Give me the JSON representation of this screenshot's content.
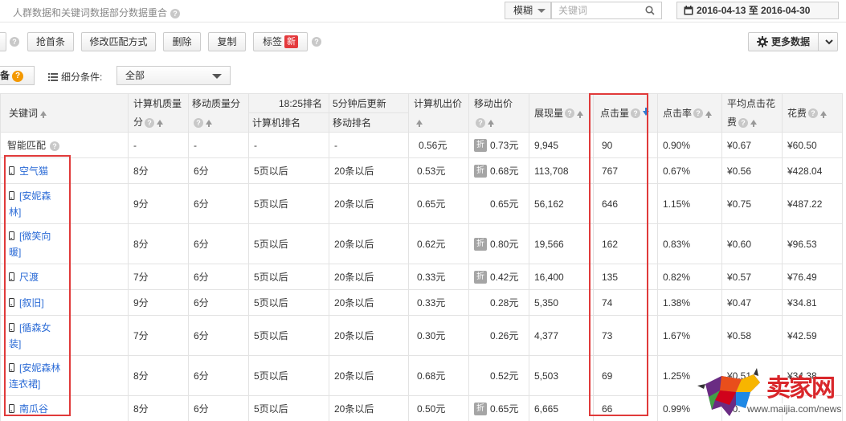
{
  "topbar": {
    "title": "人群数据和关键词数据部分数据重合",
    "fuzzy_label": "模糊",
    "search_placeholder": "关键词",
    "date_range": "2016-04-13 至 2016-04-30"
  },
  "toolbar": {
    "btn_grab": "抢首条",
    "btn_modify_match": "修改匹配方式",
    "btn_delete": "删除",
    "btn_copy": "复制",
    "btn_tag": "标签",
    "tag_badge": "新",
    "more_data": "更多数据"
  },
  "filter": {
    "equip_label": "备",
    "equip_badge": "?",
    "condition_label": "细分条件:",
    "condition_value": "全部"
  },
  "table": {
    "headers": {
      "keyword": "关键词",
      "pc_quality_line1": "计算机质量",
      "pc_quality_line2": "分",
      "mobile_quality": "移动质量分",
      "rank_time": "18:25排名",
      "update_note": "5分钟后更新",
      "pc_rank": "计算机排名",
      "mobile_rank": "移动排名",
      "pc_bid": "计算机出价",
      "mobile_bid": "移动出价",
      "impressions": "展现量",
      "clicks": "点击量",
      "ctr": "点击率",
      "avg_cpc_line1": "平均点击花",
      "avg_cpc_line2": "费",
      "cost": "花费"
    },
    "summary": {
      "keyword": "智能匹配",
      "pc_quality": "-",
      "mobile_quality": "-",
      "pc_rank": "-",
      "mobile_rank": "-",
      "pc_bid": "0.56元",
      "mobile_bid": "0.73元",
      "impressions": "9,945",
      "clicks": "90",
      "ctr": "0.90%",
      "avg_cpc": "¥0.67",
      "cost": "¥60.50"
    },
    "discount_label": "折",
    "rows": [
      {
        "kw1": "空气猫",
        "kw2": "",
        "pc_quality": "8分",
        "mobile_quality": "6分",
        "pc_rank": "5页以后",
        "mobile_rank": "20条以后",
        "pc_bid": "0.53元",
        "mobile_bid": "0.68元",
        "discount": true,
        "impressions": "113,708",
        "clicks": "767",
        "ctr": "0.67%",
        "avg_cpc": "¥0.56",
        "cost": "¥428.04"
      },
      {
        "kw1": "[安妮森",
        "kw2": "林]",
        "pc_quality": "9分",
        "mobile_quality": "6分",
        "pc_rank": "5页以后",
        "mobile_rank": "20条以后",
        "pc_bid": "0.65元",
        "mobile_bid": "0.65元",
        "discount": false,
        "impressions": "56,162",
        "clicks": "646",
        "ctr": "1.15%",
        "avg_cpc": "¥0.75",
        "cost": "¥487.22"
      },
      {
        "kw1": "[微笑向",
        "kw2": "暖]",
        "pc_quality": "8分",
        "mobile_quality": "6分",
        "pc_rank": "5页以后",
        "mobile_rank": "20条以后",
        "pc_bid": "0.62元",
        "mobile_bid": "0.80元",
        "discount": true,
        "impressions": "19,566",
        "clicks": "162",
        "ctr": "0.83%",
        "avg_cpc": "¥0.60",
        "cost": "¥96.53"
      },
      {
        "kw1": "尺渡",
        "kw2": "",
        "pc_quality": "7分",
        "mobile_quality": "6分",
        "pc_rank": "5页以后",
        "mobile_rank": "20条以后",
        "pc_bid": "0.33元",
        "mobile_bid": "0.42元",
        "discount": true,
        "impressions": "16,400",
        "clicks": "135",
        "ctr": "0.82%",
        "avg_cpc": "¥0.57",
        "cost": "¥76.49"
      },
      {
        "kw1": "[叙旧]",
        "kw2": "",
        "pc_quality": "9分",
        "mobile_quality": "6分",
        "pc_rank": "5页以后",
        "mobile_rank": "20条以后",
        "pc_bid": "0.33元",
        "mobile_bid": "0.28元",
        "discount": false,
        "impressions": "5,350",
        "clicks": "74",
        "ctr": "1.38%",
        "avg_cpc": "¥0.47",
        "cost": "¥34.81"
      },
      {
        "kw1": "[循森女",
        "kw2": "装]",
        "pc_quality": "7分",
        "mobile_quality": "6分",
        "pc_rank": "5页以后",
        "mobile_rank": "20条以后",
        "pc_bid": "0.30元",
        "mobile_bid": "0.26元",
        "discount": false,
        "impressions": "4,377",
        "clicks": "73",
        "ctr": "1.67%",
        "avg_cpc": "¥0.58",
        "cost": "¥42.59"
      },
      {
        "kw1": "[安妮森林",
        "kw2": "连衣裙]",
        "pc_quality": "8分",
        "mobile_quality": "6分",
        "pc_rank": "5页以后",
        "mobile_rank": "20条以后",
        "pc_bid": "0.68元",
        "mobile_bid": "0.52元",
        "discount": false,
        "impressions": "5,503",
        "clicks": "69",
        "ctr": "1.25%",
        "avg_cpc": "¥0.51",
        "cost": "¥34.38"
      },
      {
        "kw1": "南瓜谷",
        "kw2": "",
        "pc_quality": "8分",
        "mobile_quality": "6分",
        "pc_rank": "5页以后",
        "mobile_rank": "20条以后",
        "pc_bid": "0.50元",
        "mobile_bid": "0.65元",
        "discount": true,
        "impressions": "6,665",
        "clicks": "66",
        "ctr": "0.99%",
        "avg_cpc": "¥0.",
        "cost": ""
      }
    ]
  },
  "watermark": {
    "brand": "卖家网",
    "url": "www.maijia.com/news"
  },
  "colors": {
    "link": "#2b6bd6",
    "highlight": "#e03a3a",
    "new_badge": "#e4393c",
    "header_bg": "#f3f3f3"
  }
}
